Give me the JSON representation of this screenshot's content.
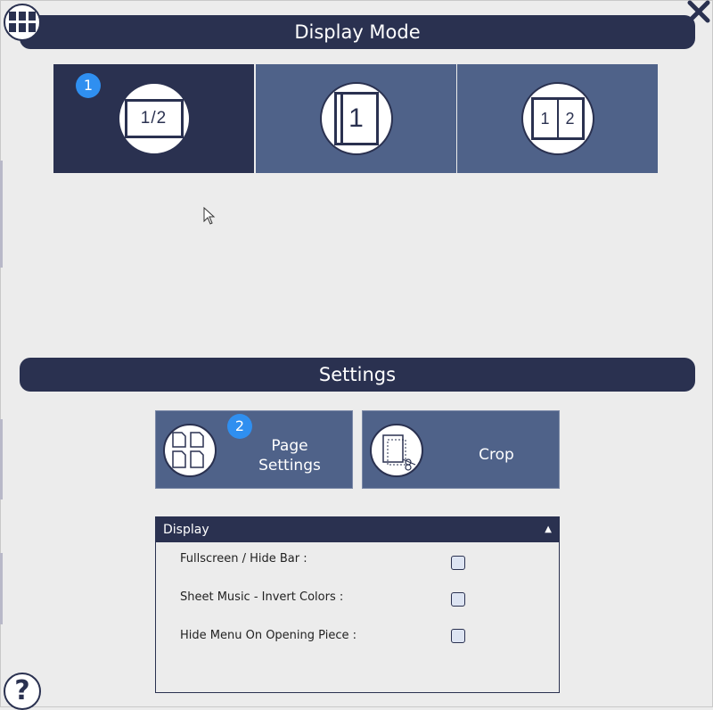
{
  "header": {
    "title": "Display Mode",
    "close_icon": "close-icon",
    "menu_icon": "grid-menu-icon"
  },
  "display_modes": [
    {
      "label": "1/2",
      "badge": "1",
      "selected": true
    },
    {
      "label": "1",
      "selected": false
    },
    {
      "label_left": "1",
      "label_right": "2",
      "selected": false
    }
  ],
  "settings": {
    "title": "Settings",
    "page_settings": {
      "label_line1": "Page",
      "label_line2": "Settings",
      "badge": "2",
      "icon": "pages-icon"
    },
    "crop": {
      "label": "Crop",
      "icon": "crop-scissors-icon"
    }
  },
  "display_panel": {
    "title": "Display",
    "options": [
      {
        "label": "Fullscreen / Hide Bar :",
        "checked": false
      },
      {
        "label": "Sheet Music - Invert Colors :",
        "checked": false
      },
      {
        "label": "Hide Menu On Opening Piece :",
        "checked": false
      }
    ]
  },
  "help": {
    "label": "?"
  },
  "colors": {
    "navy": "#2a3150",
    "tile": "#4f6289",
    "badge": "#2f8ff0",
    "background": "#ececec"
  }
}
